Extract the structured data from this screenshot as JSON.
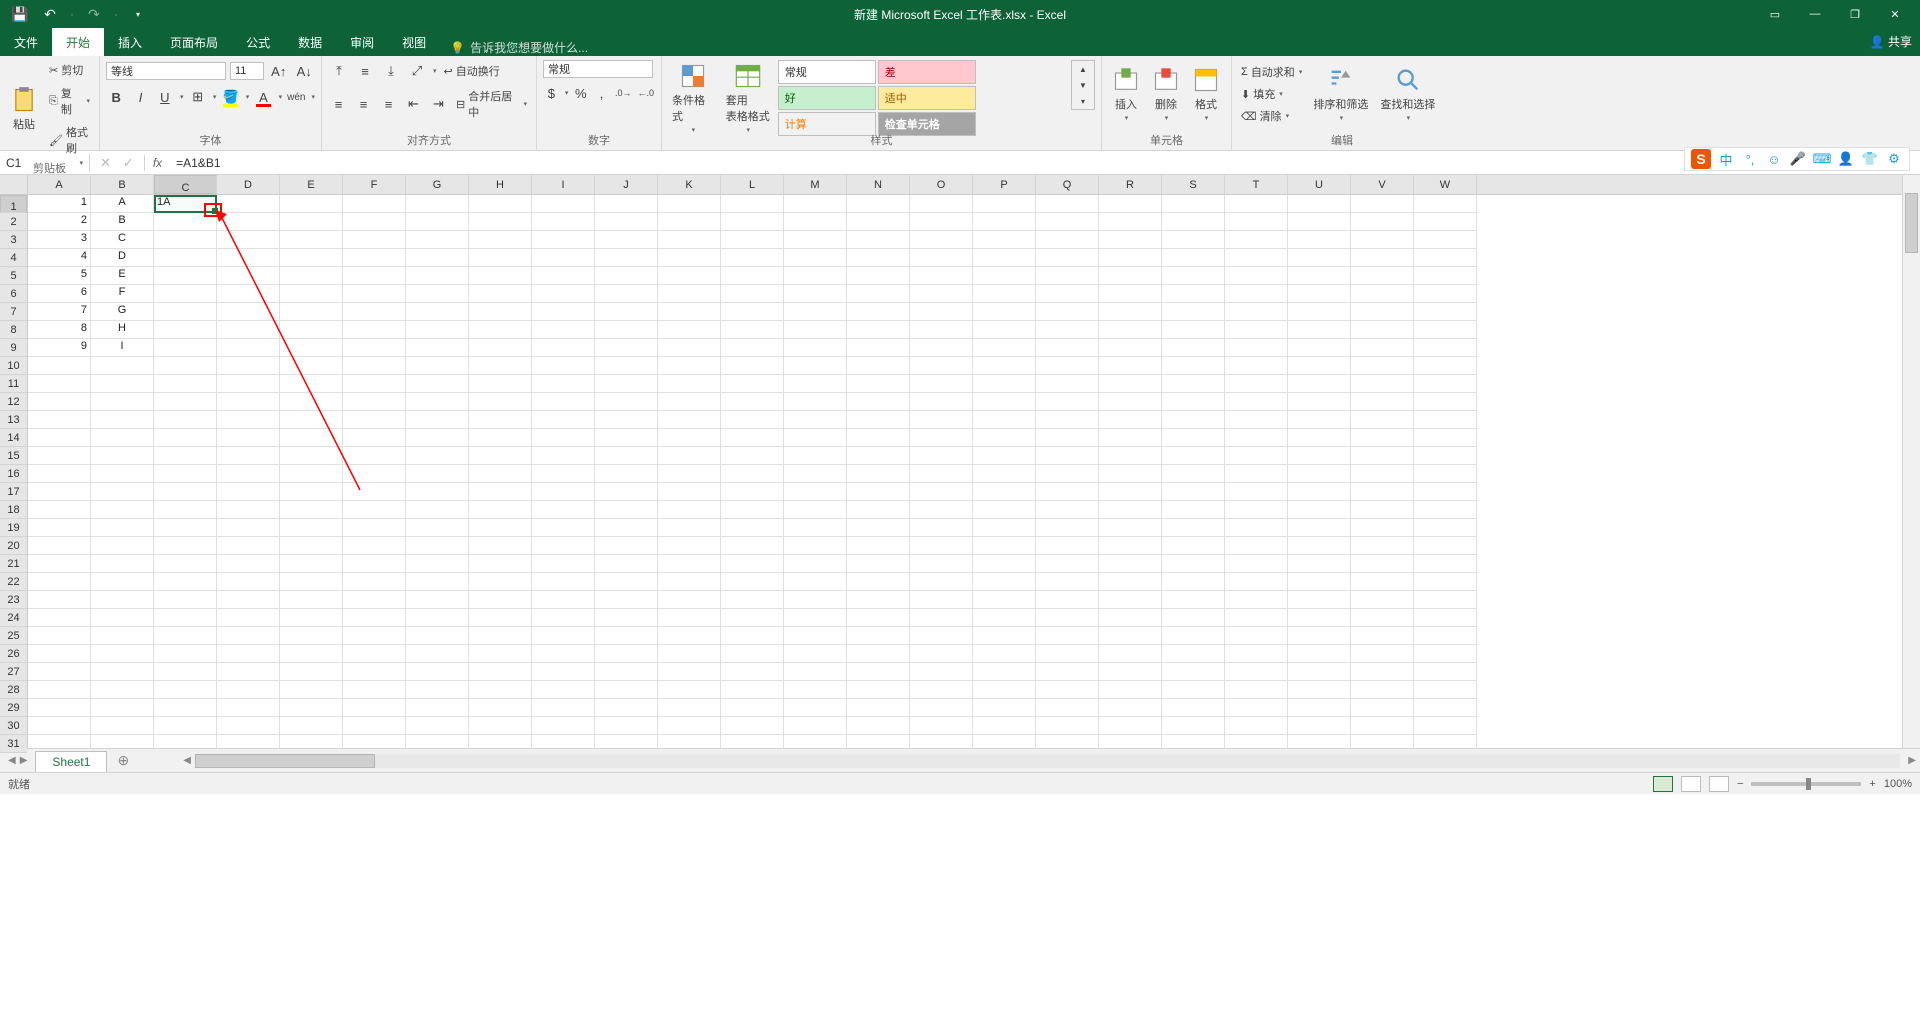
{
  "window": {
    "title_full": "新建 Microsoft Excel 工作表.xlsx - Excel"
  },
  "qat": {
    "save": "save-icon",
    "undo": "undo-icon",
    "redo": "redo-icon"
  },
  "tabs": {
    "file": "文件",
    "home": "开始",
    "insert": "插入",
    "layout": "页面布局",
    "formulas": "公式",
    "data": "数据",
    "review": "审阅",
    "view": "视图",
    "tellme": "告诉我您想要做什么...",
    "share": "共享"
  },
  "ribbon": {
    "clipboard": {
      "label": "剪贴板",
      "paste": "粘贴",
      "cut": "剪切",
      "copy": "复制",
      "painter": "格式刷"
    },
    "font": {
      "label": "字体",
      "name": "等线",
      "size": "11"
    },
    "align": {
      "label": "对齐方式",
      "wrap": "自动换行",
      "merge": "合并后居中"
    },
    "number": {
      "label": "数字",
      "format": "常规"
    },
    "styles": {
      "label": "样式",
      "condfmt": "条件格式",
      "tablefmt": "套用\n表格格式",
      "normal": "常规",
      "bad": "差",
      "good": "好",
      "neutral": "适中",
      "calc": "计算",
      "check": "检查单元格"
    },
    "cells": {
      "label": "单元格",
      "insert": "插入",
      "delete": "删除",
      "format": "格式"
    },
    "editing": {
      "label": "编辑",
      "autosum": "自动求和",
      "fill": "填充",
      "clear": "清除",
      "sort": "排序和筛选",
      "find": "查找和选择"
    }
  },
  "namebox": "C1",
  "formula": "=A1&B1",
  "columns": [
    "A",
    "B",
    "C",
    "D",
    "E",
    "F",
    "G",
    "H",
    "I",
    "J",
    "K",
    "L",
    "M",
    "N",
    "O",
    "P",
    "Q",
    "R",
    "S",
    "T",
    "U",
    "V",
    "W"
  ],
  "rows": [
    1,
    2,
    3,
    4,
    5,
    6,
    7,
    8,
    9,
    10,
    11,
    12,
    13,
    14,
    15,
    16,
    17,
    18,
    19,
    20,
    21,
    22,
    23,
    24,
    25,
    26,
    27,
    28,
    29,
    30,
    31
  ],
  "data": {
    "A": [
      "1",
      "2",
      "3",
      "4",
      "5",
      "6",
      "7",
      "8",
      "9"
    ],
    "B": [
      "A",
      "B",
      "C",
      "D",
      "E",
      "F",
      "G",
      "H",
      "I"
    ],
    "C": [
      "1A"
    ]
  },
  "sheet": {
    "name": "Sheet1"
  },
  "status": {
    "ready": "就绪",
    "zoom": "100%"
  },
  "ime": {
    "s": "S",
    "cn": "中"
  }
}
